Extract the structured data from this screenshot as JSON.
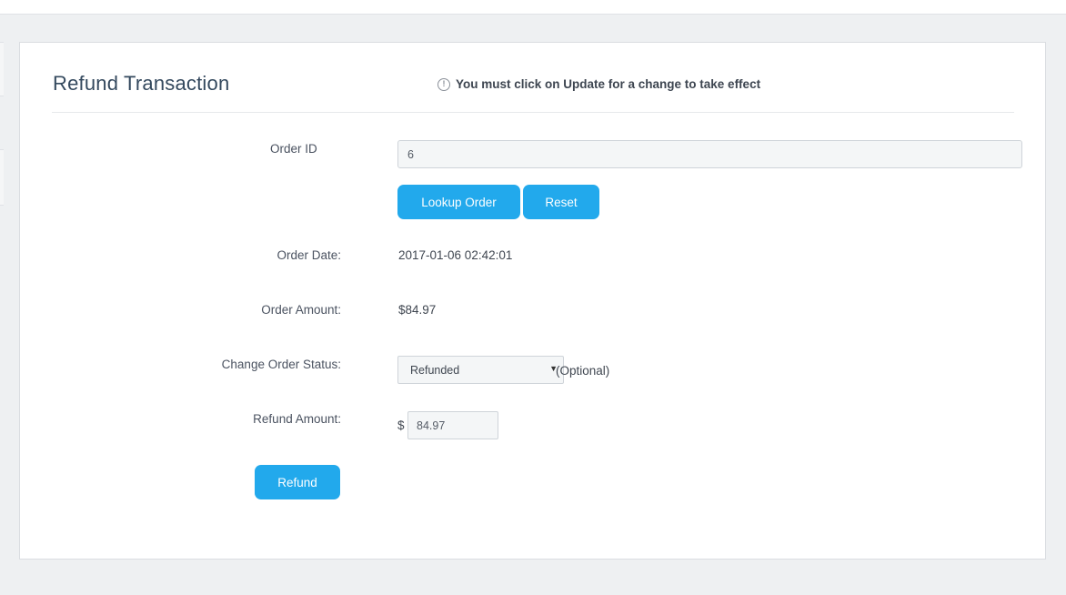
{
  "header": {
    "title": "Refund Transaction",
    "notice": "You must click on Update for a change to take effect",
    "notice_icon": "info-circle-icon"
  },
  "form": {
    "order_id_label": "Order ID",
    "order_id_value": "6",
    "lookup_button": "Lookup Order",
    "reset_button": "Reset",
    "order_date_label": "Order Date:",
    "order_date_value": "2017-01-06 02:42:01",
    "order_amount_label": "Order Amount:",
    "order_amount_value": "$84.97",
    "status_label": "Change Order Status:",
    "status_selected": "Refunded",
    "status_optional": "(Optional)",
    "refund_amount_label": "Refund Amount:",
    "currency_symbol": "$",
    "refund_amount_value": "84.97",
    "refund_button": "Refund"
  },
  "colors": {
    "accent": "#22a9ec",
    "background": "#eef0f2",
    "card": "#ffffff"
  }
}
